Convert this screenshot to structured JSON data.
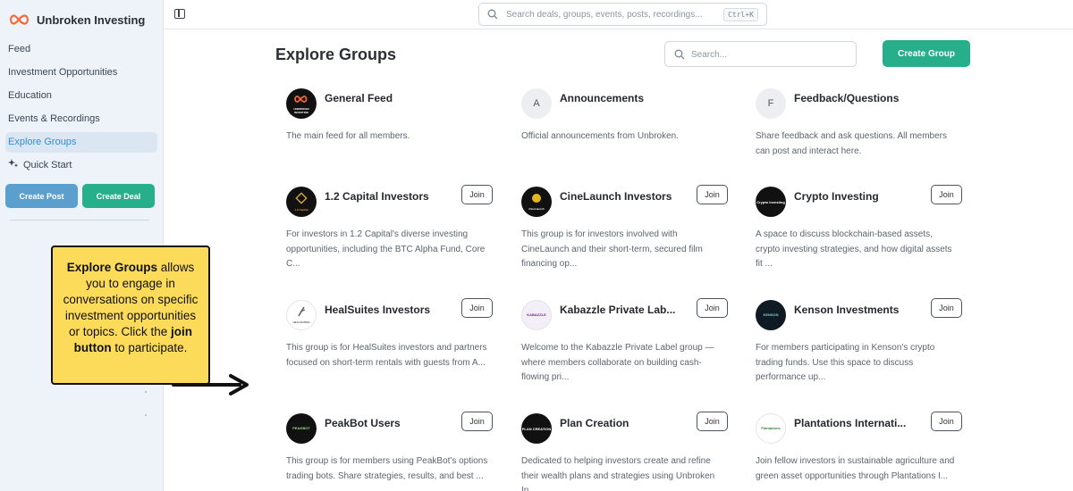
{
  "brand": {
    "name": "Unbroken Investing",
    "logo_icon": "infinity-logo-icon",
    "accent": "#f26b3a"
  },
  "sidebar": {
    "items": [
      {
        "label": "Feed"
      },
      {
        "label": "Investment Opportunities"
      },
      {
        "label": "Education"
      },
      {
        "label": "Events & Recordings"
      },
      {
        "label": "Explore Groups",
        "active": true
      },
      {
        "label": "Quick Start",
        "icon": "sparkle-icon"
      }
    ],
    "create_post": "Create Post",
    "create_deal": "Create Deal"
  },
  "topbar": {
    "search_placeholder": "Search deals, groups, events, posts, recordings...",
    "shortcut": "Ctrl+K"
  },
  "main": {
    "title": "Explore Groups",
    "search_placeholder": "Search...",
    "create_group": "Create Group",
    "groups": [
      {
        "name": "General Feed",
        "avatar_text": "UNBROKEN INVESTING",
        "desc": "The main feed for all members.",
        "join": ""
      },
      {
        "name": "Announcements",
        "avatar_text": "A",
        "desc": "Official announcements from Unbroken.",
        "join": ""
      },
      {
        "name": "Feedback/Questions",
        "avatar_text": "F",
        "desc": "Share feedback and ask questions. All members can post and interact here.",
        "join": ""
      },
      {
        "name": "1.2 Capital Investors",
        "avatar_text": "1.2 Capital",
        "desc": "For investors in 1.2 Capital's diverse investing opportunities, including the BTC Alpha Fund, Core C...",
        "join": "Join"
      },
      {
        "name": "CineLaunch Investors",
        "avatar_text": "CineLaunch",
        "desc": "This group is for investors involved with CineLaunch and their short-term, secured film financing op...",
        "join": "Join"
      },
      {
        "name": "Crypto Investing",
        "avatar_text": "Crypto Investing",
        "desc": "A space to discuss blockchain-based assets, crypto investing strategies, and how digital assets fit ...",
        "join": "Join"
      },
      {
        "name": "HealSuites Investors",
        "avatar_text": "HEALSUITES",
        "desc": "This group is for HealSuites investors and partners focused on short-term rentals with guests from A...",
        "join": "Join"
      },
      {
        "name": "Kabazzle Private Lab...",
        "avatar_text": "KABAZZLE",
        "desc": "Welcome to the Kabazzle Private Label group — where members collaborate on building cash-flowing pri...",
        "join": "Join"
      },
      {
        "name": "Kenson Investments",
        "avatar_text": "KENSON",
        "desc": "For members participating in Kenson's crypto trading funds. Use this space to discuss performance up...",
        "join": "Join"
      },
      {
        "name": "PeakBot Users",
        "avatar_text": "PEAKBOT",
        "desc": "This group is for members using PeakBot's options trading bots. Share strategies, results, and best ...",
        "join": "Join"
      },
      {
        "name": "Plan Creation",
        "avatar_text": "PLAN CREATION",
        "desc": "Dedicated to helping investors create and refine their wealth plans and strategies using Unbroken In...",
        "join": "Join"
      },
      {
        "name": "Plantations Internati...",
        "avatar_text": "Plantations",
        "desc": "Join fellow investors in sustainable agriculture and green asset opportunities through Plantations I...",
        "join": "Join"
      }
    ]
  },
  "callout": {
    "b1": "Explore Groups",
    "t1": " allows you to engage in conversations on specific investment opportunities or topics. Click the ",
    "b2": "join button",
    "t2": " to participate."
  }
}
